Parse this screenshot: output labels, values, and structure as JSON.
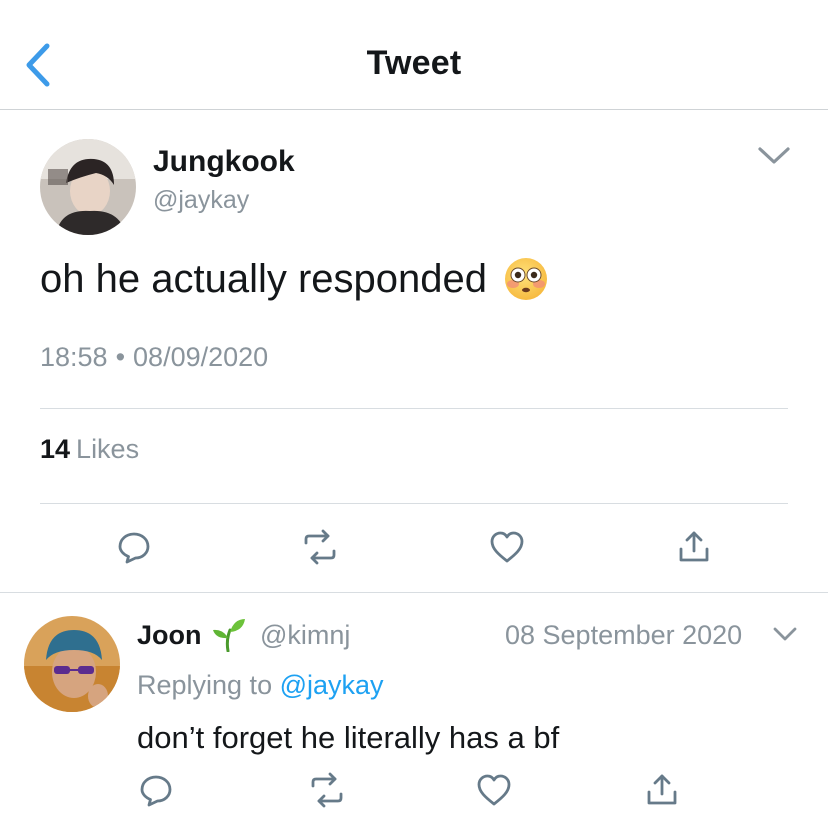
{
  "header": {
    "title": "Tweet"
  },
  "tweet": {
    "author_name": "Jungkook",
    "author_handle": "@jaykay",
    "text": "oh he actually responded",
    "emoji": "flushed-face",
    "time": "18:58",
    "separator": "•",
    "date": "08/09/2020",
    "likes_count": "14",
    "likes_label": "Likes"
  },
  "reply": {
    "author_name": "Joon",
    "author_emoji": "seedling",
    "author_handle": "@kimnj",
    "date": "08 September 2020",
    "replying_prefix": "Replying to",
    "replying_to": "@jaykay",
    "text": "don’t forget he literally has a bf"
  },
  "colors": {
    "accent": "#1da1f2",
    "back_chevron": "#3d9be9",
    "secondary_text": "#8a949c",
    "icon_gray": "#667a89",
    "divider": "#d8dde1"
  },
  "icons": {
    "back": "chevron-left-icon",
    "menu": "chevron-down-icon",
    "reply": "comment-icon",
    "retweet": "retweet-icon",
    "like": "heart-icon",
    "share": "share-icon"
  }
}
